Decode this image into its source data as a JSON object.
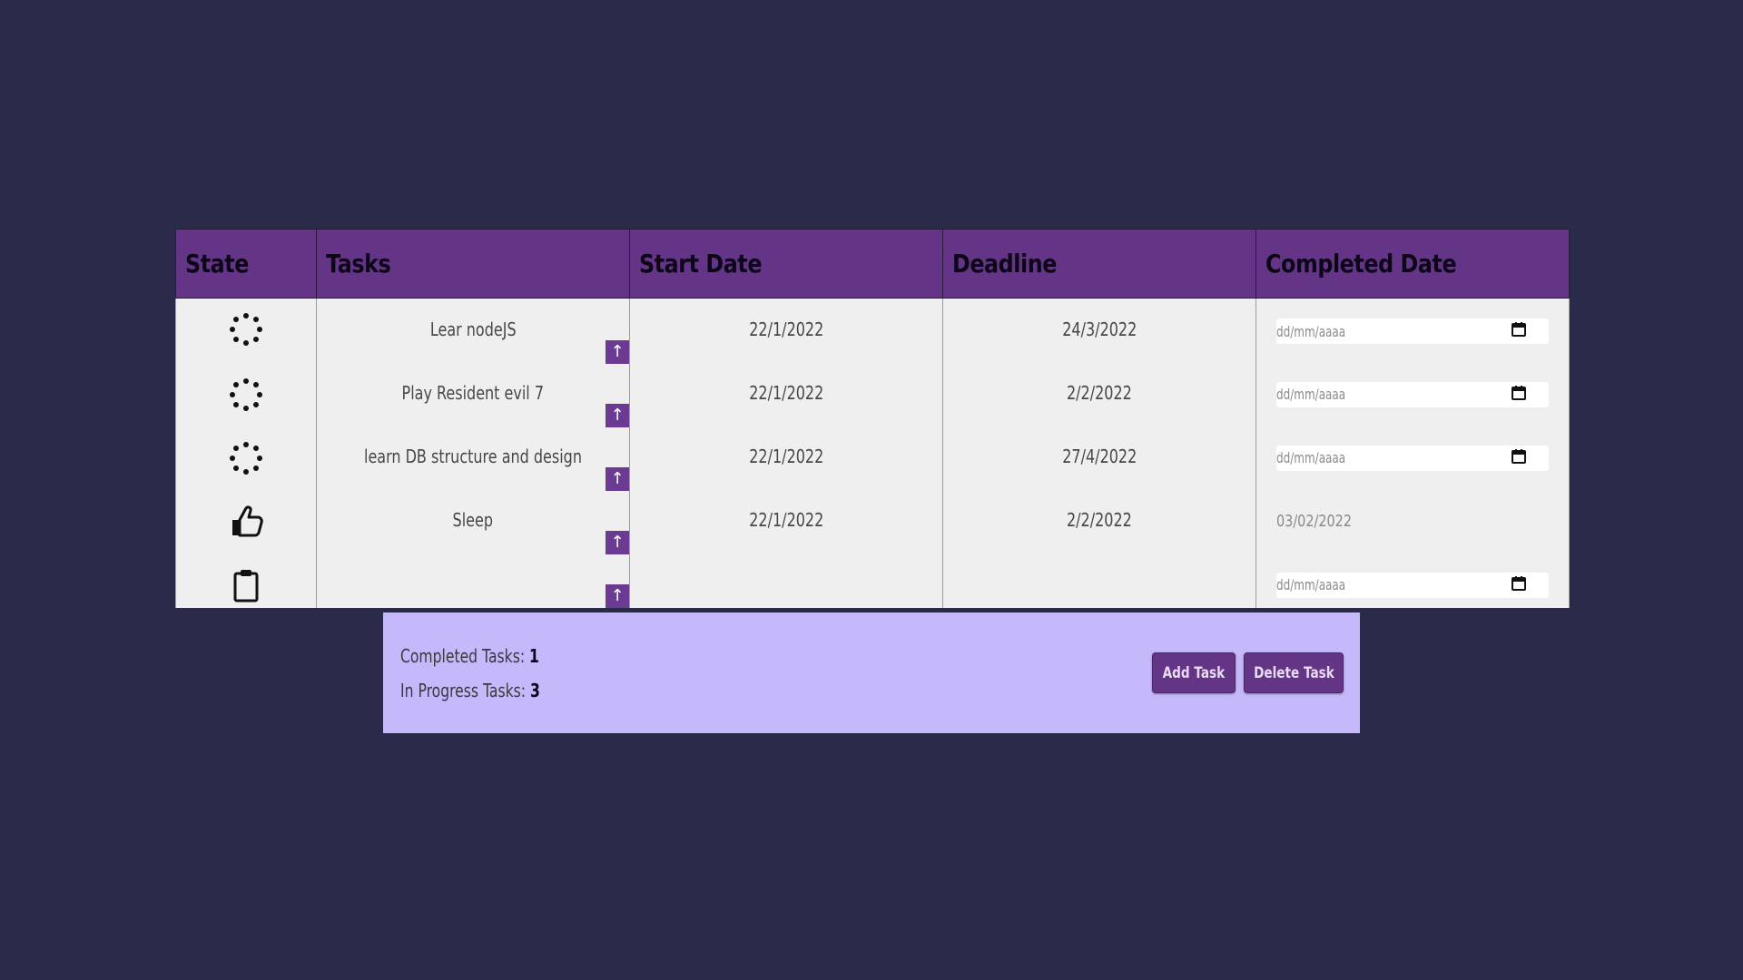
{
  "colors": {
    "background": "#2a2a4a",
    "header": "#643586",
    "row": "#efefef",
    "footer": "#c5b8fb",
    "button": "#643586"
  },
  "table": {
    "headers": {
      "state": "State",
      "tasks": "Tasks",
      "start_date": "Start Date",
      "deadline": "Deadline",
      "completed_date": "Completed Date"
    },
    "rows": [
      {
        "state_icon": "loading-dots-icon",
        "task": "Lear nodeJS",
        "start_date": "22/1/2022",
        "deadline": "24/3/2022",
        "completed": {
          "type": "input",
          "placeholder": "dd/mm/aaaa"
        },
        "up_label": "↑"
      },
      {
        "state_icon": "loading-dots-icon",
        "task": "Play Resident evil 7",
        "start_date": "22/1/2022",
        "deadline": "2/2/2022",
        "completed": {
          "type": "input",
          "placeholder": "dd/mm/aaaa"
        },
        "up_label": "↑"
      },
      {
        "state_icon": "loading-dots-icon",
        "task": "learn DB structure and design",
        "start_date": "22/1/2022",
        "deadline": "27/4/2022",
        "completed": {
          "type": "input",
          "placeholder": "dd/mm/aaaa"
        },
        "up_label": "↑"
      },
      {
        "state_icon": "thumbs-up-icon",
        "task": "Sleep",
        "start_date": "22/1/2022",
        "deadline": "2/2/2022",
        "completed": {
          "type": "text",
          "value": "03/02/2022"
        },
        "up_label": "↑"
      },
      {
        "state_icon": "clipboard-icon",
        "task": "",
        "start_date": "",
        "deadline": "",
        "completed": {
          "type": "input",
          "placeholder": "dd/mm/aaaa"
        },
        "up_label": "↑"
      }
    ]
  },
  "footer": {
    "completed_label": "Completed Tasks: ",
    "completed_count": "1",
    "in_progress_label": "In Progress Tasks: ",
    "in_progress_count": "3",
    "add_button": "Add Task",
    "delete_button": "Delete Task"
  }
}
